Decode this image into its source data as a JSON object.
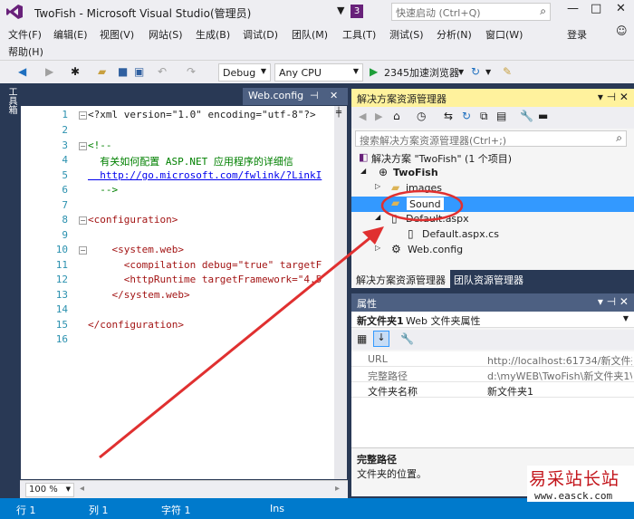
{
  "window": {
    "title": "TwoFish - Microsoft Visual Studio(管理员)",
    "notification_count": "3",
    "quick_launch_placeholder": "快速启动 (Ctrl+Q)",
    "minimize": "—",
    "maximize": "□",
    "close": "✕"
  },
  "menu": {
    "items": [
      "文件(F)",
      "编辑(E)",
      "视图(V)",
      "网站(S)",
      "生成(B)",
      "调试(D)",
      "团队(M)",
      "工具(T)",
      "测试(S)",
      "分析(N)",
      "窗口(W)",
      "帮助(H)"
    ],
    "login": "登录"
  },
  "toolbar": {
    "config": "Debug",
    "platform": "Any CPU",
    "run_target": "2345加速浏览器"
  },
  "toolbox": {
    "label": "工具箱"
  },
  "editor": {
    "tab_label": "Web.config",
    "zoom": "100 %",
    "lines": [
      {
        "n": "1",
        "text": "<?xml version=\"1.0\" encoding=\"utf-8\"?>"
      },
      {
        "n": "2",
        "text": ""
      },
      {
        "n": "3",
        "text": "<!--"
      },
      {
        "n": "4",
        "text": "  有关如何配置 ASP.NET 应用程序的详细信"
      },
      {
        "n": "5",
        "text": "  http://go.microsoft.com/fwlink/?LinkI"
      },
      {
        "n": "6",
        "text": "  -->"
      },
      {
        "n": "7",
        "text": ""
      },
      {
        "n": "8",
        "text": "<configuration>"
      },
      {
        "n": "9",
        "text": ""
      },
      {
        "n": "10",
        "text": "    <system.web>"
      },
      {
        "n": "11",
        "text": "      <compilation debug=\"true\" targetF"
      },
      {
        "n": "12",
        "text": "      <httpRuntime targetFramework=\"4.5"
      },
      {
        "n": "13",
        "text": "    </system.web>"
      },
      {
        "n": "14",
        "text": ""
      },
      {
        "n": "15",
        "text": "</configuration>"
      },
      {
        "n": "16",
        "text": ""
      }
    ]
  },
  "solution_explorer": {
    "title": "解决方案资源管理器",
    "search_placeholder": "搜索解决方案资源管理器(Ctrl+;)",
    "tree": [
      {
        "label": "解决方案 \"TwoFish\" (1 个项目)",
        "icon": "solution-icon"
      },
      {
        "label": "TwoFish",
        "icon": "website-icon"
      },
      {
        "label": "images",
        "icon": "folder-icon"
      },
      {
        "label": "Sound",
        "icon": "folder-icon"
      },
      {
        "label": "Default.aspx",
        "icon": "aspx-icon"
      },
      {
        "label": "Default.aspx.cs",
        "icon": "cs-file-icon"
      },
      {
        "label": "Web.config",
        "icon": "config-icon"
      }
    ],
    "tabs": [
      "解决方案资源管理器",
      "团队资源管理器"
    ]
  },
  "properties": {
    "title": "属性",
    "object_name": "新文件夹1",
    "object_type": "Web 文件夹属性",
    "rows": [
      {
        "key": "URL",
        "value": "http://localhost:61734/新文件夹"
      },
      {
        "key": "完整路径",
        "value": "d:\\myWEB\\TwoFish\\新文件夹1\\"
      },
      {
        "key": "文件夹名称",
        "value": "新文件夹1"
      }
    ],
    "desc_title": "完整路径",
    "desc_text": "文件夹的位置。"
  },
  "status": {
    "line": "行 1",
    "col": "列 1",
    "char": "字符 1",
    "mode": "Ins"
  },
  "watermark": {
    "title": "易采站长站",
    "url": "www.easck.com"
  },
  "colors": {
    "accent": "#007acc",
    "frame": "#293955",
    "panel_title": "#fff29d",
    "annotation": "#e03030"
  }
}
